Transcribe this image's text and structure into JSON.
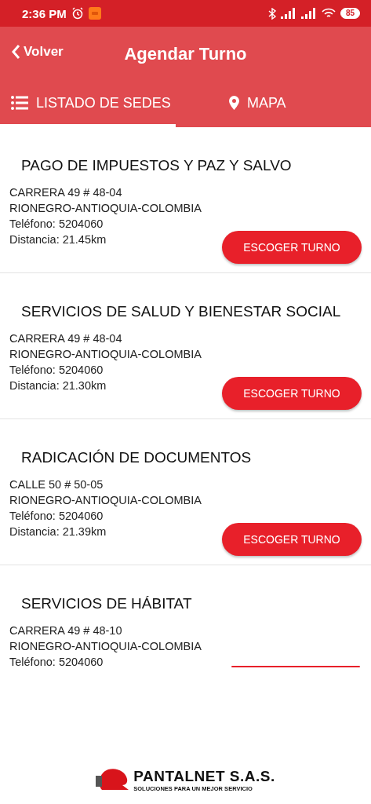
{
  "status_bar": {
    "time": "2:36 PM",
    "battery": "85"
  },
  "header": {
    "back": "Volver",
    "title": "Agendar Turno"
  },
  "tabs": [
    {
      "label": "LISTADO DE SEDES",
      "kind": "list",
      "selected": true
    },
    {
      "label": "MAPA",
      "kind": "pin",
      "selected": false
    }
  ],
  "sedes": [
    {
      "name": "PAGO DE IMPUESTOS Y PAZ Y SALVO",
      "lines": [
        "CARRERA 49 # 48-04",
        "RIONEGRO-ANTIOQUIA-COLOMBIA",
        "Teléfono: 5204060",
        "Distancia: 21.45km"
      ],
      "button": "ESCOGER TURNO"
    },
    {
      "name": "SERVICIOS DE SALUD Y BIENESTAR SOCIAL",
      "lines": [
        "CARRERA 49 # 48-04",
        "RIONEGRO-ANTIOQUIA-COLOMBIA",
        "Teléfono: 5204060",
        "Distancia: 21.30km"
      ],
      "button": "ESCOGER TURNO"
    },
    {
      "name": "RADICACIÓN DE DOCUMENTOS",
      "lines": [
        "CALLE 50 # 50-05",
        "RIONEGRO-ANTIOQUIA-COLOMBIA",
        "Teléfono: 5204060",
        "Distancia: 21.39km"
      ],
      "button": "ESCOGER TURNO"
    },
    {
      "name": "SERVICIOS DE HÁBITAT",
      "lines": [
        "CARRERA 49 # 48-10",
        "RIONEGRO-ANTIOQUIA-COLOMBIA",
        "Teléfono: 5204060"
      ],
      "button_cut": true
    }
  ],
  "footer": {
    "brand": "PANTALNET S.A.S.",
    "tagline": "SOLUCIONES PARA UN MEJOR SERVICIO"
  }
}
